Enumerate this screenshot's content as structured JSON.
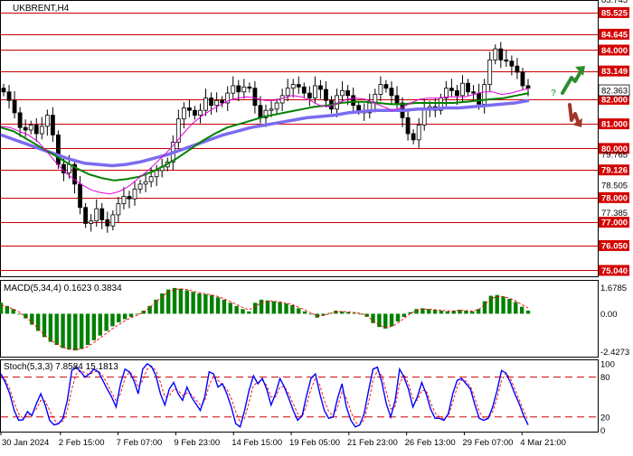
{
  "chart_data": {
    "type": "candlestick",
    "symbol_title": "UKBRENT,H4",
    "colors": {
      "level_line": "#cc0000",
      "level_label_bg": "#d40000",
      "candle": "#000000",
      "ma_fast": "#e000e0",
      "ma_mid": "#008000",
      "ma_slow": "#7b6cf0",
      "macd_hist": "#008000",
      "macd_signal": "#ff0000",
      "stoch_main": "#0000ff",
      "stoch_signal": "#ff0000",
      "arrow_up": "#2e8b2e",
      "arrow_down": "#a0352a",
      "question": "#4caf50"
    },
    "price_axis": {
      "ylim": [
        74.8,
        86.0
      ],
      "ticks": [
        "85.525",
        "84.645",
        "84.000",
        "83.149",
        "82.000",
        "81.000",
        "80.000",
        "79.126",
        "78.000",
        "77.000",
        "76.050",
        "75.040"
      ],
      "unlabeled_ticks": [
        "79.765",
        "78.505",
        "77.385"
      ],
      "top_partial_tick": "85.745"
    },
    "levels": [
      85.525,
      84.645,
      84.0,
      83.149,
      82.0,
      81.0,
      80.0,
      79.126,
      78.0,
      77.0,
      76.05,
      75.04
    ],
    "current_price": "82.363",
    "time_axis": {
      "labels": [
        "30 Jan 2024",
        "2 Feb 15:00",
        "7 Feb 07:00",
        "9 Feb 23:00",
        "14 Feb 15:00",
        "19 Feb 05:00",
        "21 Feb 23:00",
        "26 Feb 13:00",
        "29 Feb 07:00",
        "4 Mar 21:00"
      ]
    },
    "candles_close": [
      82.3,
      81.95,
      81.45,
      80.85,
      80.75,
      80.95,
      80.6,
      80.9,
      81.35,
      80.55,
      79.35,
      79.0,
      79.35,
      78.55,
      77.6,
      76.95,
      77.05,
      77.55,
      77.1,
      76.85,
      77.3,
      77.75,
      78.05,
      77.95,
      78.35,
      78.55,
      78.65,
      78.85,
      79.1,
      79.25,
      79.45,
      80.25,
      81.2,
      81.65,
      81.55,
      81.35,
      81.55,
      82.05,
      81.75,
      81.95,
      81.85,
      82.25,
      82.55,
      82.3,
      82.5,
      82.45,
      81.75,
      81.25,
      81.55,
      81.6,
      81.85,
      82.15,
      82.45,
      82.6,
      82.5,
      82.25,
      82.05,
      82.55,
      82.4,
      81.95,
      81.6,
      82.15,
      82.35,
      82.15,
      81.75,
      81.55,
      81.45,
      81.85,
      82.2,
      82.6,
      82.45,
      82.15,
      81.85,
      81.25,
      80.6,
      80.35,
      80.95,
      81.65,
      81.7,
      81.55,
      82.05,
      82.45,
      82.35,
      82.15,
      82.65,
      82.3,
      82.25,
      81.8,
      82.6,
      83.6,
      84.05,
      83.6,
      83.55,
      83.35,
      83.1,
      82.55,
      82.45
    ],
    "ma_fast": [
      80.9,
      80.85,
      80.7,
      80.55,
      80.3,
      79.9,
      79.45,
      79.05,
      78.75,
      78.5,
      78.3,
      78.2,
      78.15,
      78.25,
      78.45,
      78.75,
      79.05,
      79.4,
      79.75,
      80.15,
      80.6,
      81.0,
      81.3,
      81.55,
      81.75,
      81.95,
      82.05,
      82.1,
      82.05,
      81.95,
      81.95,
      82.05,
      82.15,
      82.1,
      81.95,
      81.75,
      81.7,
      81.85,
      82.0,
      82.05,
      82.0,
      81.85,
      81.7,
      81.55,
      81.65,
      81.85,
      82.0,
      82.05,
      82.05,
      82.1,
      82.1,
      82.1,
      82.2,
      82.3,
      82.3,
      82.2,
      82.25,
      82.35,
      82.45
    ],
    "ma_mid": [
      80.85,
      80.7,
      80.4,
      80.1,
      79.8,
      79.5,
      79.2,
      78.95,
      78.8,
      78.7,
      78.75,
      78.85,
      79.05,
      79.3,
      79.6,
      79.95,
      80.3,
      80.6,
      80.85,
      81.0,
      81.15,
      81.3,
      81.4,
      81.5,
      81.6,
      81.7,
      81.75,
      81.85,
      81.9,
      81.9,
      81.85,
      81.8,
      81.8,
      81.85,
      81.85,
      81.85,
      81.85,
      81.9,
      81.95,
      82.0,
      82.05,
      82.15,
      82.25
    ],
    "ma_slow": [
      80.55,
      80.35,
      80.15,
      79.95,
      79.75,
      79.55,
      79.4,
      79.35,
      79.3,
      79.35,
      79.45,
      79.6,
      79.75,
      79.95,
      80.15,
      80.35,
      80.55,
      80.7,
      80.85,
      80.95,
      81.05,
      81.15,
      81.25,
      81.3,
      81.35,
      81.45,
      81.5,
      81.55,
      81.55,
      81.55,
      81.6,
      81.6,
      81.65,
      81.65,
      81.7,
      81.75,
      81.8,
      81.85,
      81.95
    ],
    "macd": {
      "label": "MACD(5,34,4) 0.1623 0.3834",
      "axis": [
        "1.6785",
        "0.00",
        "-2.4273"
      ],
      "ylim": [
        -2.75,
        2.05
      ],
      "hist": [
        0.7,
        0.5,
        0.3,
        0.0,
        -0.3,
        -0.7,
        -1.1,
        -1.5,
        -1.8,
        -2.0,
        -2.2,
        -2.3,
        -2.35,
        -2.25,
        -2.0,
        -1.7,
        -1.4,
        -1.1,
        -0.8,
        -0.55,
        -0.35,
        -0.2,
        -0.05,
        0.2,
        0.5,
        0.9,
        1.3,
        1.55,
        1.65,
        1.6,
        1.5,
        1.4,
        1.3,
        1.25,
        1.2,
        1.05,
        0.9,
        0.7,
        0.5,
        0.3,
        0.15,
        0.7,
        0.9,
        0.85,
        0.8,
        0.75,
        0.65,
        0.55,
        0.35,
        0.15,
        -0.05,
        -0.25,
        -0.1,
        0.05,
        0.2,
        0.15,
        0.1,
        0.05,
        0.0,
        -0.2,
        -0.6,
        -0.85,
        -0.95,
        -0.8,
        -0.5,
        -0.2,
        0.1,
        0.3,
        0.35,
        0.3,
        0.25,
        0.2,
        0.15,
        0.2,
        0.25,
        0.2,
        0.15,
        0.3,
        0.8,
        1.15,
        1.2,
        1.1,
        0.95,
        0.75,
        0.45,
        0.2
      ],
      "signal": [
        0.55,
        0.45,
        0.3,
        0.1,
        -0.2,
        -0.55,
        -0.95,
        -1.35,
        -1.7,
        -1.95,
        -2.15,
        -2.25,
        -2.3,
        -2.25,
        -2.1,
        -1.85,
        -1.55,
        -1.25,
        -0.95,
        -0.7,
        -0.45,
        -0.25,
        -0.1,
        0.1,
        0.4,
        0.75,
        1.1,
        1.4,
        1.55,
        1.6,
        1.55,
        1.45,
        1.35,
        1.28,
        1.2,
        1.1,
        0.95,
        0.78,
        0.6,
        0.4,
        0.25,
        0.45,
        0.7,
        0.8,
        0.8,
        0.75,
        0.68,
        0.58,
        0.42,
        0.25,
        0.05,
        -0.12,
        -0.12,
        0.0,
        0.12,
        0.15,
        0.12,
        0.08,
        0.02,
        -0.12,
        -0.45,
        -0.72,
        -0.88,
        -0.82,
        -0.6,
        -0.3,
        0.0,
        0.2,
        0.3,
        0.3,
        0.26,
        0.22,
        0.18,
        0.18,
        0.22,
        0.2,
        0.17,
        0.25,
        0.6,
        0.95,
        1.1,
        1.1,
        1.0,
        0.82,
        0.58,
        0.38
      ]
    },
    "stoch": {
      "label": "Stoch(5,3,3) 7.8584 15.1813",
      "axis": [
        "100",
        "80",
        "20",
        "0"
      ],
      "ylim": [
        -2,
        104
      ],
      "k": [
        85,
        72,
        55,
        30,
        15,
        16,
        28,
        22,
        40,
        55,
        38,
        15,
        8,
        10,
        18,
        45,
        90,
        95,
        88,
        80,
        85,
        92,
        88,
        75,
        62,
        50,
        35,
        70,
        92,
        88,
        75,
        55,
        92,
        100,
        96,
        82,
        55,
        38,
        62,
        72,
        55,
        45,
        65,
        50,
        40,
        30,
        50,
        88,
        85,
        65,
        70,
        55,
        35,
        10,
        5,
        30,
        60,
        82,
        70,
        78,
        62,
        38,
        55,
        78,
        65,
        48,
        30,
        15,
        22,
        52,
        78,
        85,
        55,
        30,
        18,
        20,
        48,
        70,
        35,
        15,
        5,
        8,
        25,
        60,
        92,
        95,
        72,
        40,
        20,
        45,
        92,
        80,
        62,
        35,
        50,
        72,
        55,
        32,
        18,
        18,
        15,
        25,
        55,
        75,
        78,
        70,
        62,
        38,
        18,
        15,
        18,
        35,
        60,
        90,
        86,
        72,
        55,
        40,
        22,
        8
      ],
      "d": [
        80,
        76,
        62,
        42,
        25,
        18,
        22,
        25,
        32,
        45,
        44,
        30,
        16,
        10,
        14,
        30,
        62,
        85,
        90,
        86,
        84,
        88,
        89,
        82,
        70,
        57,
        44,
        55,
        78,
        88,
        82,
        65,
        75,
        92,
        96,
        90,
        72,
        50,
        52,
        62,
        60,
        52,
        56,
        54,
        46,
        38,
        44,
        68,
        82,
        75,
        68,
        62,
        48,
        28,
        12,
        18,
        42,
        68,
        72,
        75,
        68,
        50,
        50,
        65,
        66,
        55,
        40,
        25,
        20,
        38,
        62,
        78,
        68,
        45,
        28,
        22,
        35,
        58,
        48,
        28,
        12,
        8,
        16,
        42,
        75,
        90,
        82,
        58,
        32,
        36,
        70,
        84,
        70,
        48,
        45,
        60,
        60,
        42,
        26,
        20,
        17,
        22,
        42,
        65,
        76,
        74,
        66,
        48,
        28,
        18,
        18,
        28,
        48,
        75,
        86,
        78,
        62,
        46,
        30,
        15
      ]
    }
  }
}
